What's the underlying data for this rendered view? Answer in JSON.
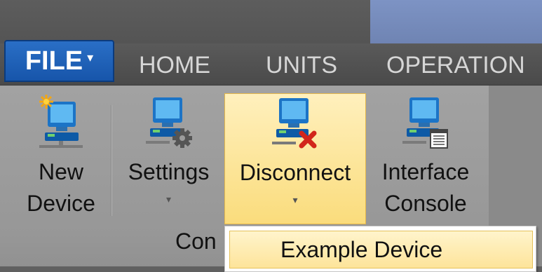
{
  "tabs": {
    "file": "FILE",
    "home": "HOME",
    "units": "UNITS",
    "operation": "OPERATION"
  },
  "ribbon": {
    "buttons": [
      {
        "label_line1": "New",
        "label_line2": "Device",
        "icon": "new-device-icon"
      },
      {
        "label_line1": "Settings",
        "dropdown": "▾",
        "icon": "device-settings-icon"
      },
      {
        "label_line1": "Disconnect",
        "dropdown": "▾",
        "icon": "disconnect-device-icon"
      },
      {
        "label_line1": "Interface",
        "label_line2": "Console",
        "icon": "interface-console-icon"
      }
    ],
    "group_label": "Con"
  },
  "dropdown_menu": {
    "items": [
      "Example Device"
    ]
  },
  "colors": {
    "file_tab": "#1d5eb5",
    "highlight": "#fadc7c",
    "ribbon": "#9c9c9c",
    "tab_text": "#d6d6d6",
    "accent_bar": "#7d93c4"
  }
}
